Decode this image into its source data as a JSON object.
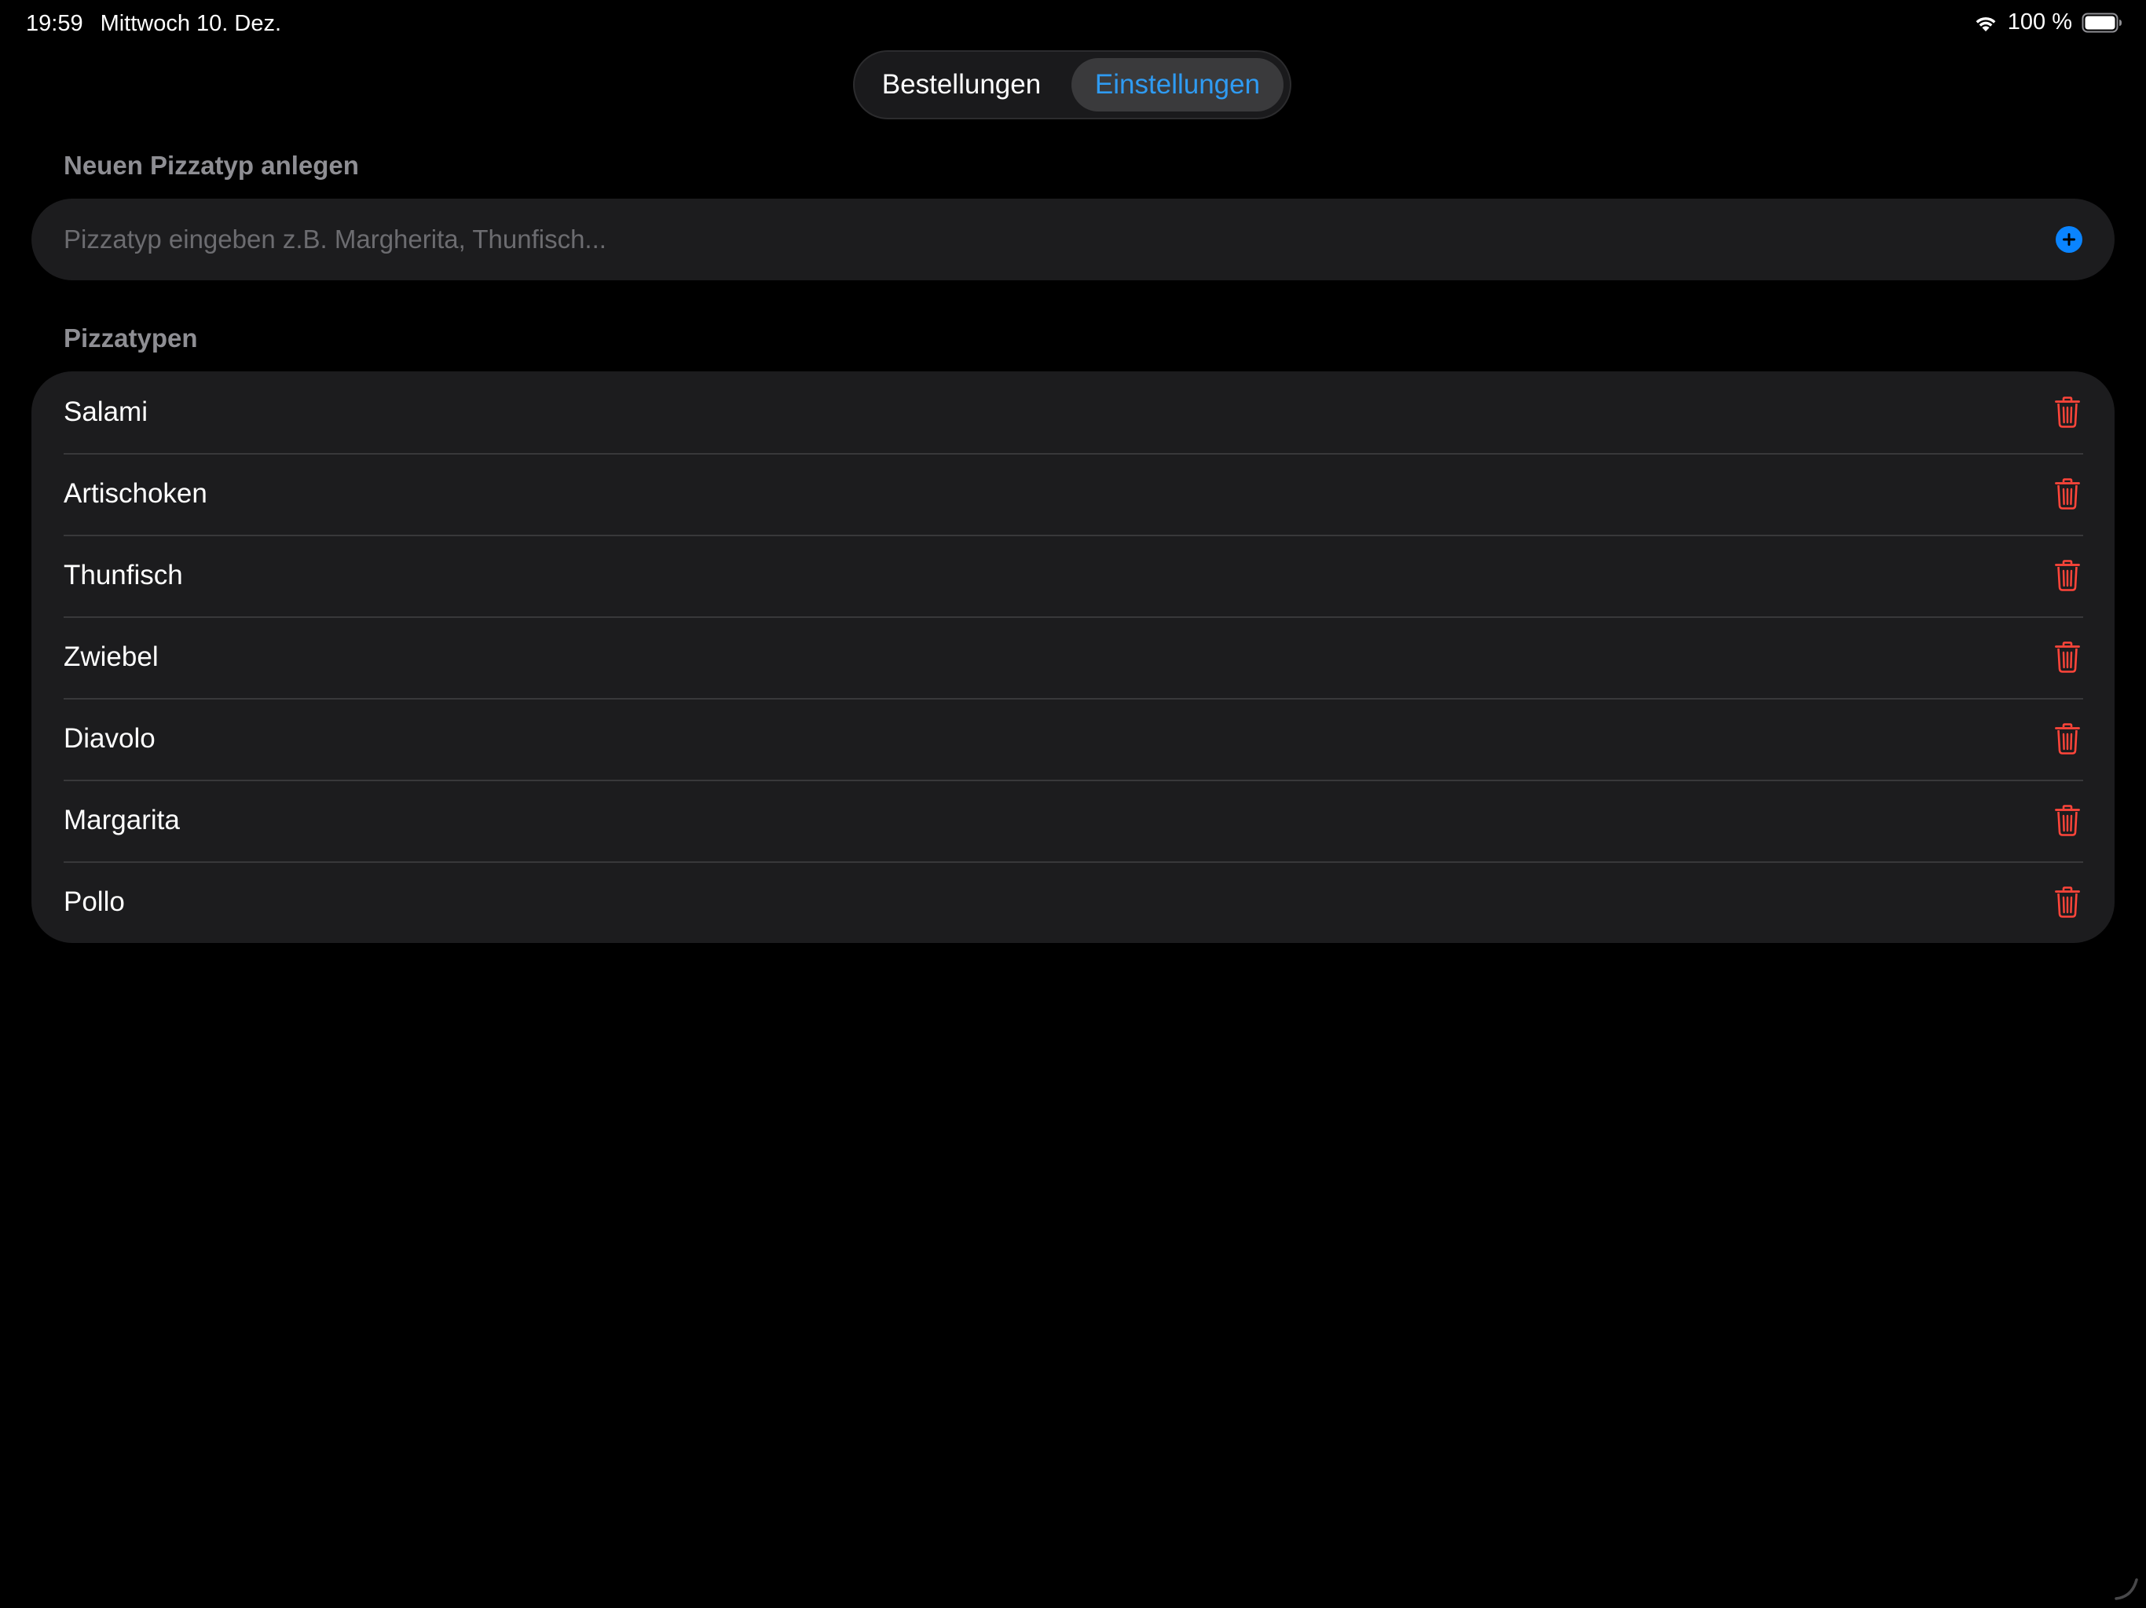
{
  "status_bar": {
    "time": "19:59",
    "date": "Mittwoch 10. Dez.",
    "battery_text": "100 %",
    "wifi_icon": "wifi-icon",
    "battery_icon": "battery-icon"
  },
  "tabs": [
    {
      "label": "Bestellungen",
      "selected": false
    },
    {
      "label": "Einstellungen",
      "selected": true
    }
  ],
  "new_type_section": {
    "header": "Neuen Pizzatyp anlegen",
    "input_value": "",
    "input_placeholder": "Pizzatyp eingeben z.B. Margherita, Thunfisch...",
    "add_icon": "plus-circle-icon"
  },
  "types_section": {
    "header": "Pizzatypen",
    "items": [
      {
        "label": "Salami"
      },
      {
        "label": "Artischoken"
      },
      {
        "label": "Thunfisch"
      },
      {
        "label": "Zwiebel"
      },
      {
        "label": "Diavolo"
      },
      {
        "label": "Margarita"
      },
      {
        "label": "Pollo"
      }
    ],
    "delete_icon": "trash-icon"
  },
  "colors": {
    "background": "#000000",
    "card": "#1c1c1e",
    "accent": "#2f9bf2",
    "add_button": "#0a84ff",
    "destructive": "#ff453a",
    "section_header": "#8e8e93",
    "placeholder": "#6c6c70"
  }
}
